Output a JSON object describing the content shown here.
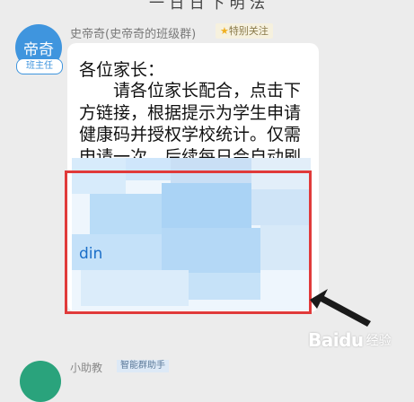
{
  "top_fragment": "一 日 日 下 明 法",
  "message": {
    "avatar_text": "帝奇",
    "role_badge": "班主任",
    "sender": "史帝奇(史帝奇的班级群)",
    "follow_badge": "特别关注",
    "greeting": "各位家长：",
    "body": "　　请各位家长配合，点击下方链接，根据提示为学生申请健康码并授权学校统计。仅需申请一次，后续每日会自动刷新",
    "link_fragment": "din"
  },
  "next_message": {
    "sender": "小助教",
    "badge": "智能群助手"
  },
  "watermark": {
    "logo": "Baidu",
    "sub": "经验"
  },
  "colors": {
    "avatar": "#3f95de",
    "highlight": "#e03a3a",
    "link": "#1a6ec8"
  }
}
